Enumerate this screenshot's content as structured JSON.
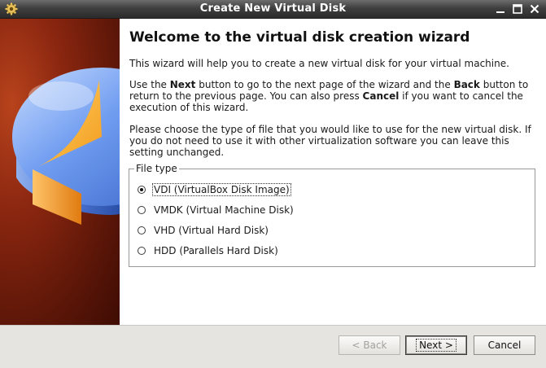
{
  "window": {
    "title": "Create New Virtual Disk"
  },
  "wizard": {
    "heading": "Welcome to the virtual disk creation wizard",
    "intro": "This wizard will help you to create a new virtual disk for your virtual machine.",
    "nav_help": {
      "t1": "Use the ",
      "next": "Next",
      "t2": " button to go to the next page of the wizard and the ",
      "back": "Back",
      "t3": " button to return to the previous page. You can also press ",
      "cancel": "Cancel",
      "t4": " if you want to cancel the execution of this wizard."
    },
    "choose_text": "Please choose the type of file that you would like to use for the new virtual disk. If you do not need to use it with other virtualization software you can leave this setting unchanged."
  },
  "file_type": {
    "legend": "File type",
    "options": [
      {
        "label": "VDI (VirtualBox Disk Image)",
        "selected": true
      },
      {
        "label": "VMDK (Virtual Machine Disk)",
        "selected": false
      },
      {
        "label": "VHD (Virtual Hard Disk)",
        "selected": false
      },
      {
        "label": "HDD (Parallels Hard Disk)",
        "selected": false
      }
    ]
  },
  "buttons": {
    "back": "< Back",
    "next": "Next >",
    "cancel": "Cancel"
  },
  "icons": {
    "window": "gear-icon",
    "minimize": "minimize-icon",
    "maximize": "maximize-icon",
    "close": "close-icon",
    "side": "disk-pie-illustration"
  },
  "colors": {
    "titlebar": "#3f3f3f",
    "side_panel": "#8a2610",
    "pie_blue": "#5f8fe0",
    "pie_orange": "#f5a623"
  }
}
